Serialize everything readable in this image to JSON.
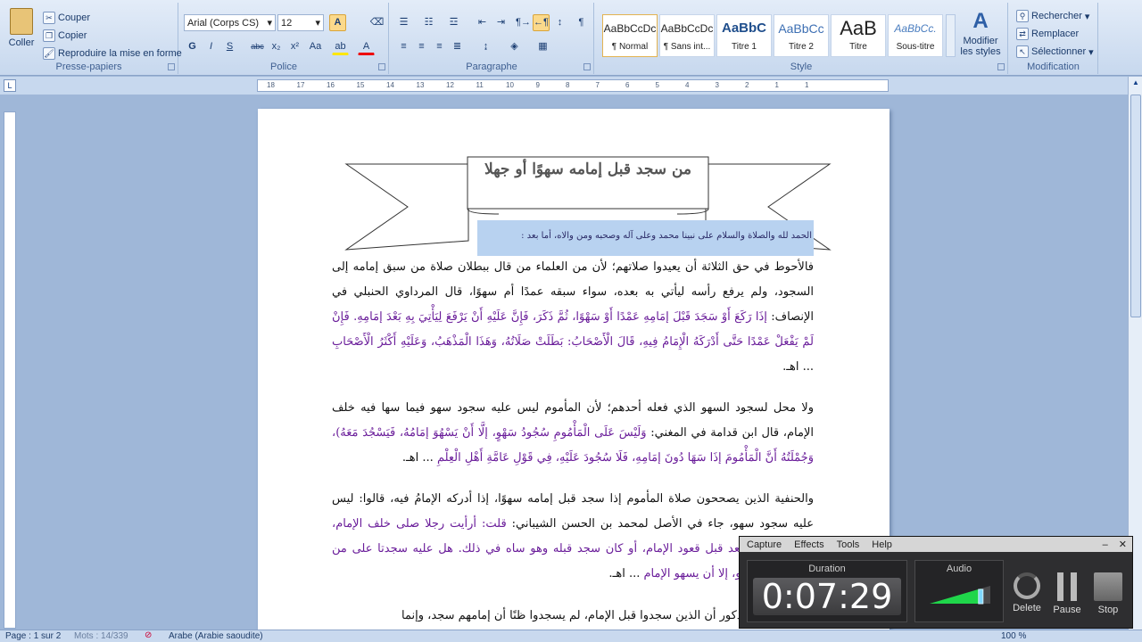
{
  "clipboard": {
    "paste": "Coller",
    "cut": "Couper",
    "copy": "Copier",
    "format_painter": "Reproduire la mise en forme",
    "label": "Presse-papiers"
  },
  "font": {
    "name": "Arial (Corps CS)",
    "size": "12",
    "label": "Police",
    "bold": "G",
    "italic": "I",
    "underline": "S",
    "strike": "abc",
    "subscript": "x₂",
    "superscript": "x²",
    "case": "Aa"
  },
  "paragraph": {
    "label": "Paragraphe"
  },
  "styles": {
    "label": "Style",
    "items": [
      {
        "sample": "AaBbCcDc",
        "name": "¶ Normal"
      },
      {
        "sample": "AaBbCcDc",
        "name": "¶ Sans int..."
      },
      {
        "sample": "AaBbC",
        "name": "Titre 1"
      },
      {
        "sample": "AaBbCc",
        "name": "Titre 2"
      },
      {
        "sample": "AaB",
        "name": "Titre"
      },
      {
        "sample": "AaBbCc.",
        "name": "Sous-titre"
      }
    ],
    "change": "Modifier les styles"
  },
  "editing": {
    "find": "Rechercher",
    "replace": "Remplacer",
    "select": "Sélectionner",
    "label": "Modification"
  },
  "ruler": {
    "ticks": [
      "18",
      "17",
      "16",
      "15",
      "14",
      "13",
      "12",
      "11",
      "10",
      "9",
      "8",
      "7",
      "6",
      "5",
      "4",
      "3",
      "2",
      "1",
      "1"
    ]
  },
  "doc": {
    "banner": "من سجد قبل إمامه سهوًا أو جهلا",
    "intro": "الحمد لله والصلاة والسلام على نبينا محمد وعلى آله وصحبه ومن والاه، أما بعد :",
    "p1a": "فالأحوط في حق الثلاثة أن يعيدوا صلاتهم؛ لأن من العلماء من قال ببطلان صلاة من سبق إمامه إلى السجود، ولم يرفع رأسه ليأتي به بعده، سواء سبقه عمدًا أم سهوًا، قال المرداوي الحنبلي في الإنصاف:",
    "p1q": "إذَا رَكَعَ أَوْ سَجَدَ قَبْلَ إمَامِهِ عَمْدًا أَوْ سَهْوًا، ثُمَّ ذَكَرَ، فَإِنَّ عَلَيْهِ أَنْ يَرْفَعَ لِيَأْتِيَ بِهِ بَعْدَ إمَامِهِ. فَإِنْ لَمْ يَفْعَلْ عَمْدًا حَتَّى أَدْرَكَهُ الْإِمَامُ فِيهِ، قَالَ الْأَصْحَابُ: بَطَلَتْ صَلَاتُهُ، وَهَذَا الْمَذْهَبُ، وَعَلَيْهِ أَكْثَرُ الْأَصْحَابِ",
    "p1end": "... اهـ.",
    "p2a": "ولا محل لسجود السهو الذي فعله أحدهم؛ لأن المأموم ليس عليه سجود سهو فيما سها فيه خلف الإمام، قال ابن قدامة في المغني:",
    "p2q": "وَلَيْسَ عَلَى الْمَأْمُومِ سُجُودُ سَهْوٍ، إلَّا أَنْ يَسْهُوَ إمَامُهُ، فَيَسْجُدَ مَعَهُ)، وَجُمْلَتُهُ أَنَّ الْمَأْمُومَ إذَا سَهَا دُونَ إمَامِهِ، فَلَا سُجُودَ عَلَيْهِ، فِي قَوْلِ عَامَّةِ أَهْلِ الْعِلْمِ",
    "p2end": "... اهـ.",
    "p3a": "والحنفية الذين يصححون صلاة المأموم إذا سجد قبل إمامه سهوًا، إذا أدركه الإمامُ فيه، قالوا: ليس عليه سجود سهو، جاء في الأصل لمحمد بن الحسن الشيباني:",
    "p3q": "قلت: أرأيت رجلا صلى خلف الإمام، وكان أو كان يقعد قبل قعود الإمام، أو كان سجد قبله وهو ساه في ذلك. هل عليه سجدتا على من خلف الإمام سهو، إلا أن يسهو الإمام",
    "p3end": "... اهـ.",
    "p4": "في السؤال المذكور أن الذين سجدوا قبل الإمام، لم يسجدوا ظنًا أن إمامهم سجد، وإنما"
  },
  "status": {
    "page": "Page : 1 sur 2",
    "words": "Mots : 14/339",
    "language": "Arabe (Arabie saoudite)",
    "zoom": "100 %"
  },
  "recorder": {
    "menu": [
      "Capture",
      "Effects",
      "Tools",
      "Help"
    ],
    "duration_label": "Duration",
    "duration": "0:07:29",
    "audio_label": "Audio",
    "audio_level": 0.85,
    "delete": "Delete",
    "pause": "Pause",
    "stop": "Stop"
  }
}
